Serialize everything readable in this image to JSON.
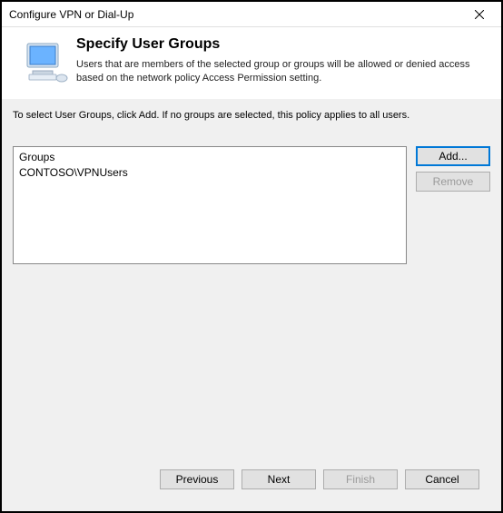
{
  "window": {
    "title": "Configure VPN or Dial-Up"
  },
  "header": {
    "title": "Specify User Groups",
    "description": "Users that are members of the selected group or groups will be allowed or denied access based on the network policy Access Permission setting."
  },
  "content": {
    "instruction": "To select User Groups, click Add. If no groups are selected, this policy applies to all users.",
    "groups_header": "Groups",
    "groups": [
      "CONTOSO\\VPNUsers"
    ],
    "add_label": "Add...",
    "remove_label": "Remove"
  },
  "footer": {
    "previous": "Previous",
    "next": "Next",
    "finish": "Finish",
    "cancel": "Cancel"
  }
}
